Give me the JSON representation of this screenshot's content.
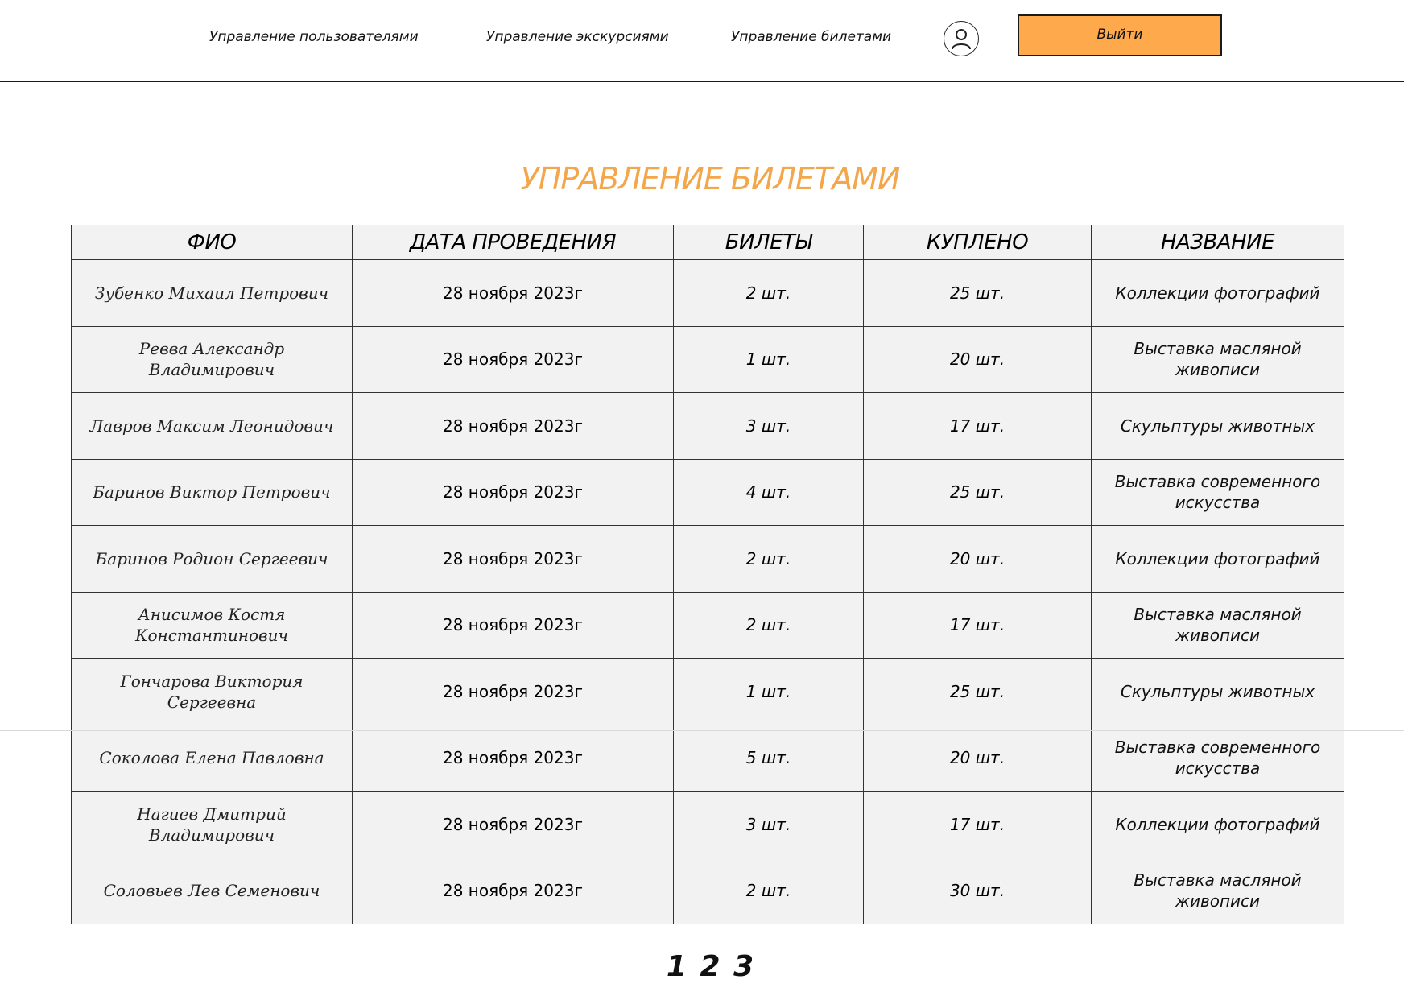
{
  "nav": {
    "users": "Управление пользователями",
    "tours": "Управление экскурсиями",
    "tickets": "Управление билетами",
    "logout": "Выйти",
    "accent": "#FFA94D"
  },
  "page": {
    "title": "УПРАВЛЕНИЕ БИЛЕТАМИ",
    "title_color": "#F4A64A"
  },
  "table": {
    "headers": [
      "ФИО",
      "ДАТА ПРОВЕДЕНИЯ",
      "БИЛЕТЫ",
      "КУПЛЕНО",
      "НАЗВАНИЕ"
    ],
    "rows": [
      {
        "name": "Зубенко Михаил Петрович",
        "date": "28 ноября 2023г",
        "tickets": "2 шт.",
        "bought": "25 шт.",
        "title": "Коллекции фотографий"
      },
      {
        "name": "Ревва Александр Владимирович",
        "date": "28 ноября 2023г",
        "tickets": "1 шт.",
        "bought": "20 шт.",
        "title": "Выставка масляной живописи"
      },
      {
        "name": "Лавров Максим Леонидович",
        "date": "28 ноября 2023г",
        "tickets": "3 шт.",
        "bought": "17 шт.",
        "title": "Скульптуры животных"
      },
      {
        "name": "Баринов Виктор Петрович",
        "date": "28 ноября 2023г",
        "tickets": "4 шт.",
        "bought": "25 шт.",
        "title": "Выставка современного искусства"
      },
      {
        "name": "Баринов Родион Сергеевич",
        "date": "28 ноября 2023г",
        "tickets": "2 шт.",
        "bought": "20 шт.",
        "title": "Коллекции фотографий"
      },
      {
        "name": "Анисимов Костя Константинович",
        "date": "28 ноября 2023г",
        "tickets": "2 шт.",
        "bought": "17 шт.",
        "title": "Выставка масляной живописи"
      },
      {
        "name": "Гончарова Виктория Сергеевна",
        "date": "28 ноября 2023г",
        "tickets": "1 шт.",
        "bought": "25 шт.",
        "title": "Скульптуры животных"
      },
      {
        "name": "Соколова Елена Павловна",
        "date": "28 ноября 2023г",
        "tickets": "5 шт.",
        "bought": "20 шт.",
        "title": "Выставка современного искусства"
      },
      {
        "name": "Нагиев Дмитрий Владимирович",
        "date": "28 ноября 2023г",
        "tickets": "3 шт.",
        "bought": "17 шт.",
        "title": "Коллекции фотографий"
      },
      {
        "name": "Соловьев Лев Семенович",
        "date": "28 ноября 2023г",
        "tickets": "2 шт.",
        "bought": "30 шт.",
        "title": "Выставка масляной живописи"
      }
    ]
  },
  "pagination": {
    "pages": [
      "1",
      "2",
      "3"
    ]
  },
  "icons": {
    "profile": "user-icon"
  }
}
